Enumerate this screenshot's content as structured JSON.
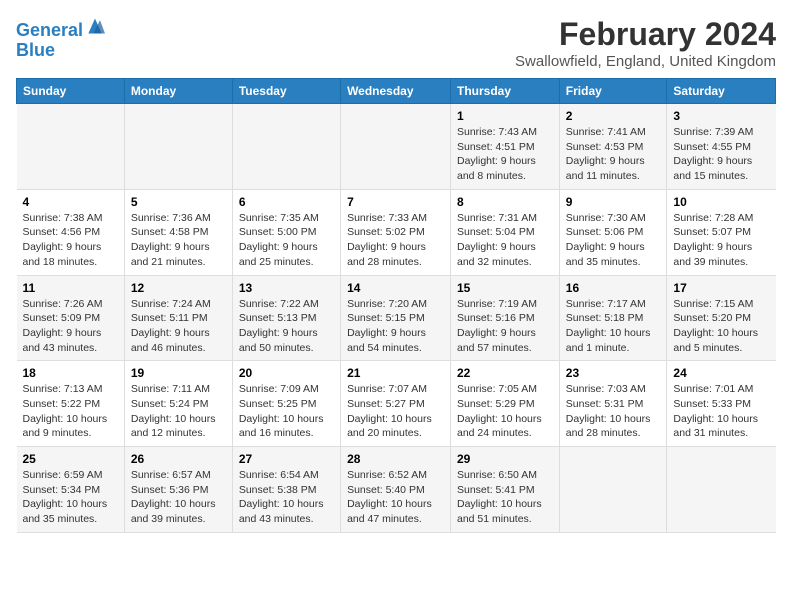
{
  "header": {
    "logo_line1": "General",
    "logo_line2": "Blue",
    "month_title": "February 2024",
    "location": "Swallowfield, England, United Kingdom"
  },
  "days_of_week": [
    "Sunday",
    "Monday",
    "Tuesday",
    "Wednesday",
    "Thursday",
    "Friday",
    "Saturday"
  ],
  "weeks": [
    [
      {
        "day": "",
        "info": ""
      },
      {
        "day": "",
        "info": ""
      },
      {
        "day": "",
        "info": ""
      },
      {
        "day": "",
        "info": ""
      },
      {
        "day": "1",
        "info": "Sunrise: 7:43 AM\nSunset: 4:51 PM\nDaylight: 9 hours\nand 8 minutes."
      },
      {
        "day": "2",
        "info": "Sunrise: 7:41 AM\nSunset: 4:53 PM\nDaylight: 9 hours\nand 11 minutes."
      },
      {
        "day": "3",
        "info": "Sunrise: 7:39 AM\nSunset: 4:55 PM\nDaylight: 9 hours\nand 15 minutes."
      }
    ],
    [
      {
        "day": "4",
        "info": "Sunrise: 7:38 AM\nSunset: 4:56 PM\nDaylight: 9 hours\nand 18 minutes."
      },
      {
        "day": "5",
        "info": "Sunrise: 7:36 AM\nSunset: 4:58 PM\nDaylight: 9 hours\nand 21 minutes."
      },
      {
        "day": "6",
        "info": "Sunrise: 7:35 AM\nSunset: 5:00 PM\nDaylight: 9 hours\nand 25 minutes."
      },
      {
        "day": "7",
        "info": "Sunrise: 7:33 AM\nSunset: 5:02 PM\nDaylight: 9 hours\nand 28 minutes."
      },
      {
        "day": "8",
        "info": "Sunrise: 7:31 AM\nSunset: 5:04 PM\nDaylight: 9 hours\nand 32 minutes."
      },
      {
        "day": "9",
        "info": "Sunrise: 7:30 AM\nSunset: 5:06 PM\nDaylight: 9 hours\nand 35 minutes."
      },
      {
        "day": "10",
        "info": "Sunrise: 7:28 AM\nSunset: 5:07 PM\nDaylight: 9 hours\nand 39 minutes."
      }
    ],
    [
      {
        "day": "11",
        "info": "Sunrise: 7:26 AM\nSunset: 5:09 PM\nDaylight: 9 hours\nand 43 minutes."
      },
      {
        "day": "12",
        "info": "Sunrise: 7:24 AM\nSunset: 5:11 PM\nDaylight: 9 hours\nand 46 minutes."
      },
      {
        "day": "13",
        "info": "Sunrise: 7:22 AM\nSunset: 5:13 PM\nDaylight: 9 hours\nand 50 minutes."
      },
      {
        "day": "14",
        "info": "Sunrise: 7:20 AM\nSunset: 5:15 PM\nDaylight: 9 hours\nand 54 minutes."
      },
      {
        "day": "15",
        "info": "Sunrise: 7:19 AM\nSunset: 5:16 PM\nDaylight: 9 hours\nand 57 minutes."
      },
      {
        "day": "16",
        "info": "Sunrise: 7:17 AM\nSunset: 5:18 PM\nDaylight: 10 hours\nand 1 minute."
      },
      {
        "day": "17",
        "info": "Sunrise: 7:15 AM\nSunset: 5:20 PM\nDaylight: 10 hours\nand 5 minutes."
      }
    ],
    [
      {
        "day": "18",
        "info": "Sunrise: 7:13 AM\nSunset: 5:22 PM\nDaylight: 10 hours\nand 9 minutes."
      },
      {
        "day": "19",
        "info": "Sunrise: 7:11 AM\nSunset: 5:24 PM\nDaylight: 10 hours\nand 12 minutes."
      },
      {
        "day": "20",
        "info": "Sunrise: 7:09 AM\nSunset: 5:25 PM\nDaylight: 10 hours\nand 16 minutes."
      },
      {
        "day": "21",
        "info": "Sunrise: 7:07 AM\nSunset: 5:27 PM\nDaylight: 10 hours\nand 20 minutes."
      },
      {
        "day": "22",
        "info": "Sunrise: 7:05 AM\nSunset: 5:29 PM\nDaylight: 10 hours\nand 24 minutes."
      },
      {
        "day": "23",
        "info": "Sunrise: 7:03 AM\nSunset: 5:31 PM\nDaylight: 10 hours\nand 28 minutes."
      },
      {
        "day": "24",
        "info": "Sunrise: 7:01 AM\nSunset: 5:33 PM\nDaylight: 10 hours\nand 31 minutes."
      }
    ],
    [
      {
        "day": "25",
        "info": "Sunrise: 6:59 AM\nSunset: 5:34 PM\nDaylight: 10 hours\nand 35 minutes."
      },
      {
        "day": "26",
        "info": "Sunrise: 6:57 AM\nSunset: 5:36 PM\nDaylight: 10 hours\nand 39 minutes."
      },
      {
        "day": "27",
        "info": "Sunrise: 6:54 AM\nSunset: 5:38 PM\nDaylight: 10 hours\nand 43 minutes."
      },
      {
        "day": "28",
        "info": "Sunrise: 6:52 AM\nSunset: 5:40 PM\nDaylight: 10 hours\nand 47 minutes."
      },
      {
        "day": "29",
        "info": "Sunrise: 6:50 AM\nSunset: 5:41 PM\nDaylight: 10 hours\nand 51 minutes."
      },
      {
        "day": "",
        "info": ""
      },
      {
        "day": "",
        "info": ""
      }
    ]
  ]
}
